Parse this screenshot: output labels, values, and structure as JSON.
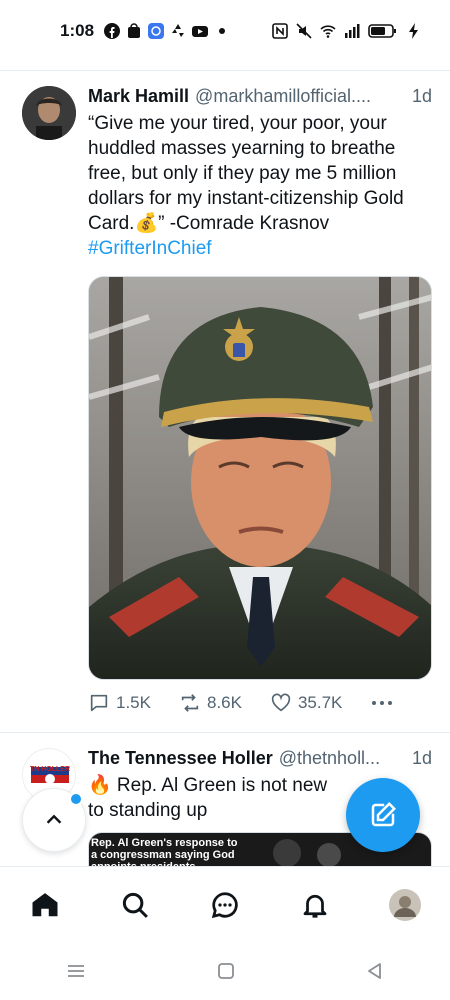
{
  "status_bar": {
    "time": "1:08"
  },
  "tweets": [
    {
      "name": "Mark Hamill",
      "handle": "@markhamillofficial....",
      "time": "1d",
      "text": "“Give me your tired, your poor, your huddled masses yearning to breathe free, but only if they pay me 5 million dollars for my instant-citizenship Gold Card.💰” -Comrade Krasnov",
      "hashtag": "#GrifterInChief",
      "replies": "1.5K",
      "retweets": "8.6K",
      "likes": "35.7K"
    },
    {
      "name": "The Tennessee Holler",
      "handle": "@thetnholl...",
      "time": "1d",
      "text": "🔥 Rep. Al Green is not new to standing up",
      "media_caption": "Rep. Al Green's response to a congressman saying God appoints presidents...",
      "avatar_text": "TN HOLLER"
    }
  ],
  "colors": {
    "accent": "#1d9bf0",
    "muted": "#536471"
  }
}
